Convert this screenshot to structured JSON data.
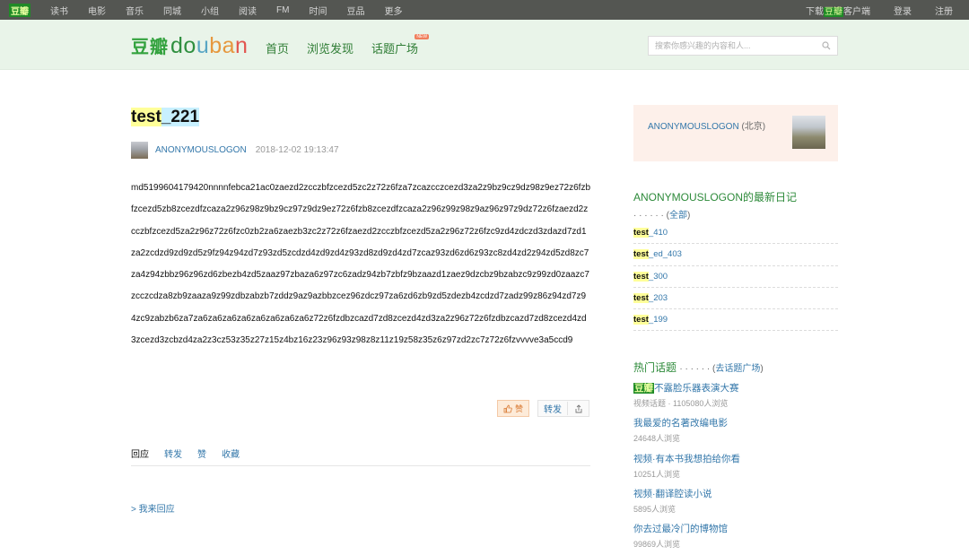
{
  "topbar": {
    "logo": "豆瓣",
    "nav": [
      "读书",
      "电影",
      "音乐",
      "同城",
      "小组",
      "阅读",
      "FM",
      "时间",
      "豆品",
      "更多"
    ],
    "download_pre": "下载",
    "download_hl": "豆瓣",
    "download_post": "客户端",
    "login": "登录",
    "register": "注册"
  },
  "header": {
    "brand_cn": "豆瓣",
    "brand_en": [
      "do",
      "u",
      "ba",
      "n"
    ],
    "nav": [
      "首页",
      "浏览发现",
      "话题广场"
    ],
    "new_badge": "NEW",
    "search_placeholder": "搜索你感兴趣的内容和人..."
  },
  "article": {
    "title_hl": "test",
    "title_rest": "_221",
    "author": "ANONYMOUSLOGON",
    "timestamp": "2018-12-02 19:13:47",
    "body": "md5199604179420nnnnfebca21ac0zaezd2zcczbfzcezd5zc2z72z6fza7zcazcczcezd3za2z9bz9cz9dz98z9ez72z6fzbfzcezd5zb8zcezdfzcaza2z96z98z9bz9cz97z9dz9ez72z6fzb8zcezdfzcaza2z96z99z98z9az96z97z9dz72z6fzaezd2zcczbfzcezd5za2z96z72z6fzc0zb2za6zaezb3zc2z72z6fzaezd2zcczbfzcezd5za2z96z72z6fzc9zd4zdczd3zdazd7zd1za2zcdzd9zd9zd5z9fz94z94zd7z93zd5zcdzd4zd9zd4z93zd8zd9zd4zd7zcaz93zd6zd6z93zc8zd4zd2z94zd5zd8zc7za4z94zbbz96z96zd6zbezb4zd5zaaz97zbaza6z97zc6zadz94zb7zbfz9bzaazd1zaez9dzcbz9bzabzc9z99zd0zaazc7zcczcdza8zb9zaaza9z99zdbzabzb7zddz9az9azbbzcez96zdcz97za6zd6zb9zd5zdezb4zcdzd7zadz99z86z94zd7z94zc9zabzb6za7za6za6za6za6za6za6za6za6z72z6fzdbzcazd7zd8zcezd4zd3za2z96z72z6fzdbzcazd7zd8zcezd4zd3zcezd3zcbzd4za2z3cz53z35z27z15z4bz16z23z96z93z98z8z11z19z58z35z6z97zd2zc7z72z6fzvvvve3a5ccd9",
    "like_label": "赞",
    "share_label": "转发"
  },
  "tabs": [
    "回应",
    "转发",
    "赞",
    "收藏"
  ],
  "reply_link": "> 我来回应",
  "sidebar": {
    "profile_name": "ANONYMOUSLOGON",
    "profile_loc": "(北京)",
    "diary_title": "ANONYMOUSLOGON的最新日记",
    "diary_sub_pre": "· · · · · · (",
    "diary_sub_link": "全部",
    "diary_sub_post": ")",
    "diaries": [
      {
        "kw": "test",
        "rest": "_410"
      },
      {
        "kw": "test",
        "rest": "_ed_403"
      },
      {
        "kw": "test",
        "rest": "_300"
      },
      {
        "kw": "test",
        "rest": "_203"
      },
      {
        "kw": "test",
        "rest": "_199"
      }
    ],
    "topics_title": "热门话题",
    "topics_sub_pre": "· · · · · · (",
    "topics_sub_link": "去话题广场",
    "topics_sub_post": ")",
    "topics": [
      {
        "hl": "豆瓣",
        "title": "不露脸乐器表演大赛",
        "meta": "视频话题 · 1105080人浏览"
      },
      {
        "hl": "",
        "title": "我最爱的名著改编电影",
        "meta": "24648人浏览"
      },
      {
        "hl": "",
        "title": "视频·有本书我想拍给你看",
        "meta": "10251人浏览"
      },
      {
        "hl": "",
        "title": "视频·翻译腔读小说",
        "meta": "5895人浏览"
      },
      {
        "hl": "",
        "title": "你去过最冷门的博物馆",
        "meta": "99869人浏览"
      }
    ]
  }
}
